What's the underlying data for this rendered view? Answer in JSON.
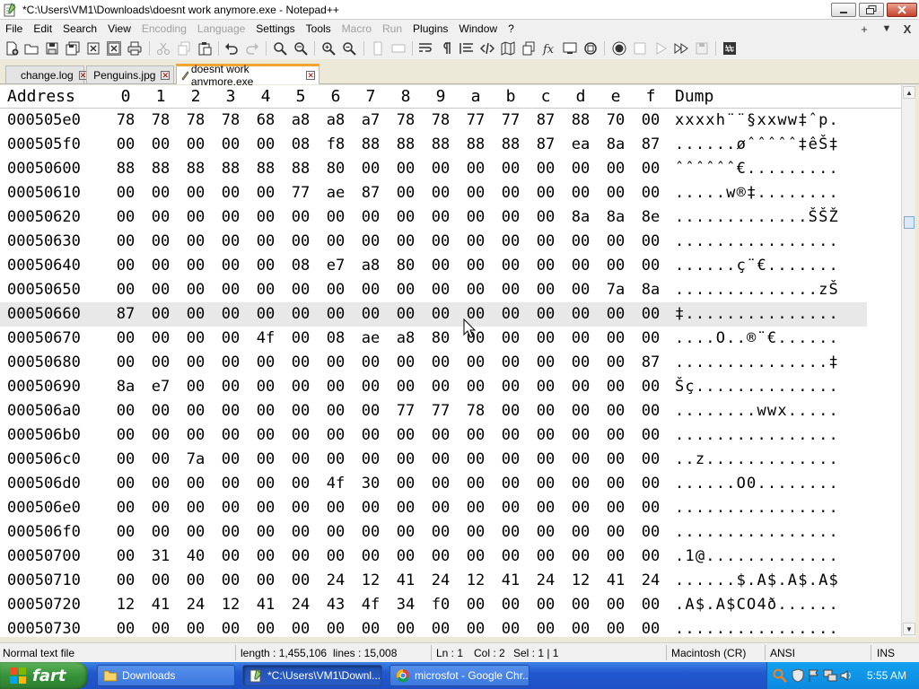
{
  "window": {
    "title": "*C:\\Users\\VM1\\Downloads\\doesnt work anymore.exe - Notepad++"
  },
  "menu": {
    "items": [
      {
        "label": "File",
        "enabled": true
      },
      {
        "label": "Edit",
        "enabled": true
      },
      {
        "label": "Search",
        "enabled": true
      },
      {
        "label": "View",
        "enabled": true
      },
      {
        "label": "Encoding",
        "enabled": false
      },
      {
        "label": "Language",
        "enabled": false
      },
      {
        "label": "Settings",
        "enabled": true
      },
      {
        "label": "Tools",
        "enabled": true
      },
      {
        "label": "Macro",
        "enabled": false
      },
      {
        "label": "Run",
        "enabled": false
      },
      {
        "label": "Plugins",
        "enabled": true
      },
      {
        "label": "Window",
        "enabled": true
      },
      {
        "label": "?",
        "enabled": true
      }
    ],
    "plus": "+",
    "dropdown": "▼",
    "close": "X"
  },
  "tabs": [
    {
      "label": "change.log",
      "active": false,
      "icon": "document-icon"
    },
    {
      "label": "Penguins.jpg",
      "active": false,
      "icon": "edit-icon"
    },
    {
      "label": "doesnt work anymore.exe",
      "active": true,
      "icon": "edit-icon"
    }
  ],
  "hex": {
    "header": {
      "address": "Address",
      "columns": [
        "0",
        "1",
        "2",
        "3",
        "4",
        "5",
        "6",
        "7",
        "8",
        "9",
        "a",
        "b",
        "c",
        "d",
        "e",
        "f"
      ],
      "dump": "Dump"
    },
    "current_row_index": 8,
    "rows": [
      {
        "addr": "000505e0",
        "bytes": [
          "78",
          "78",
          "78",
          "78",
          "68",
          "a8",
          "a8",
          "a7",
          "78",
          "78",
          "77",
          "77",
          "87",
          "88",
          "70",
          "00"
        ],
        "dump": "xxxxh¨¨§xxww‡ˆp."
      },
      {
        "addr": "000505f0",
        "bytes": [
          "00",
          "00",
          "00",
          "00",
          "00",
          "08",
          "f8",
          "88",
          "88",
          "88",
          "88",
          "88",
          "87",
          "ea",
          "8a",
          "87"
        ],
        "dump": "......øˆˆˆˆˆ‡êŠ‡"
      },
      {
        "addr": "00050600",
        "bytes": [
          "88",
          "88",
          "88",
          "88",
          "88",
          "88",
          "80",
          "00",
          "00",
          "00",
          "00",
          "00",
          "00",
          "00",
          "00",
          "00"
        ],
        "dump": "ˆˆˆˆˆˆ€........."
      },
      {
        "addr": "00050610",
        "bytes": [
          "00",
          "00",
          "00",
          "00",
          "00",
          "77",
          "ae",
          "87",
          "00",
          "00",
          "00",
          "00",
          "00",
          "00",
          "00",
          "00"
        ],
        "dump": ".....w®‡........"
      },
      {
        "addr": "00050620",
        "bytes": [
          "00",
          "00",
          "00",
          "00",
          "00",
          "00",
          "00",
          "00",
          "00",
          "00",
          "00",
          "00",
          "00",
          "8a",
          "8a",
          "8e"
        ],
        "dump": ".............ŠŠŽ"
      },
      {
        "addr": "00050630",
        "bytes": [
          "00",
          "00",
          "00",
          "00",
          "00",
          "00",
          "00",
          "00",
          "00",
          "00",
          "00",
          "00",
          "00",
          "00",
          "00",
          "00"
        ],
        "dump": "................"
      },
      {
        "addr": "00050640",
        "bytes": [
          "00",
          "00",
          "00",
          "00",
          "00",
          "08",
          "e7",
          "a8",
          "80",
          "00",
          "00",
          "00",
          "00",
          "00",
          "00",
          "00"
        ],
        "dump": "......ç¨€......."
      },
      {
        "addr": "00050650",
        "bytes": [
          "00",
          "00",
          "00",
          "00",
          "00",
          "00",
          "00",
          "00",
          "00",
          "00",
          "00",
          "00",
          "00",
          "00",
          "7a",
          "8a"
        ],
        "dump": "..............zŠ"
      },
      {
        "addr": "00050660",
        "bytes": [
          "87",
          "00",
          "00",
          "00",
          "00",
          "00",
          "00",
          "00",
          "00",
          "00",
          "00",
          "00",
          "00",
          "00",
          "00",
          "00"
        ],
        "dump": "‡..............."
      },
      {
        "addr": "00050670",
        "bytes": [
          "00",
          "00",
          "00",
          "00",
          "4f",
          "00",
          "08",
          "ae",
          "a8",
          "80",
          "00",
          "00",
          "00",
          "00",
          "00",
          "00"
        ],
        "dump": "....O..®¨€......"
      },
      {
        "addr": "00050680",
        "bytes": [
          "00",
          "00",
          "00",
          "00",
          "00",
          "00",
          "00",
          "00",
          "00",
          "00",
          "00",
          "00",
          "00",
          "00",
          "00",
          "87"
        ],
        "dump": "...............‡"
      },
      {
        "addr": "00050690",
        "bytes": [
          "8a",
          "e7",
          "00",
          "00",
          "00",
          "00",
          "00",
          "00",
          "00",
          "00",
          "00",
          "00",
          "00",
          "00",
          "00",
          "00"
        ],
        "dump": "Šç.............."
      },
      {
        "addr": "000506a0",
        "bytes": [
          "00",
          "00",
          "00",
          "00",
          "00",
          "00",
          "00",
          "00",
          "77",
          "77",
          "78",
          "00",
          "00",
          "00",
          "00",
          "00"
        ],
        "dump": "........wwx....."
      },
      {
        "addr": "000506b0",
        "bytes": [
          "00",
          "00",
          "00",
          "00",
          "00",
          "00",
          "00",
          "00",
          "00",
          "00",
          "00",
          "00",
          "00",
          "00",
          "00",
          "00"
        ],
        "dump": "................"
      },
      {
        "addr": "000506c0",
        "bytes": [
          "00",
          "00",
          "7a",
          "00",
          "00",
          "00",
          "00",
          "00",
          "00",
          "00",
          "00",
          "00",
          "00",
          "00",
          "00",
          "00"
        ],
        "dump": "..z............."
      },
      {
        "addr": "000506d0",
        "bytes": [
          "00",
          "00",
          "00",
          "00",
          "00",
          "00",
          "4f",
          "30",
          "00",
          "00",
          "00",
          "00",
          "00",
          "00",
          "00",
          "00"
        ],
        "dump": "......O0........"
      },
      {
        "addr": "000506e0",
        "bytes": [
          "00",
          "00",
          "00",
          "00",
          "00",
          "00",
          "00",
          "00",
          "00",
          "00",
          "00",
          "00",
          "00",
          "00",
          "00",
          "00"
        ],
        "dump": "................"
      },
      {
        "addr": "000506f0",
        "bytes": [
          "00",
          "00",
          "00",
          "00",
          "00",
          "00",
          "00",
          "00",
          "00",
          "00",
          "00",
          "00",
          "00",
          "00",
          "00",
          "00"
        ],
        "dump": "................"
      },
      {
        "addr": "00050700",
        "bytes": [
          "00",
          "31",
          "40",
          "00",
          "00",
          "00",
          "00",
          "00",
          "00",
          "00",
          "00",
          "00",
          "00",
          "00",
          "00",
          "00"
        ],
        "dump": ".1@............."
      },
      {
        "addr": "00050710",
        "bytes": [
          "00",
          "00",
          "00",
          "00",
          "00",
          "00",
          "24",
          "12",
          "41",
          "24",
          "12",
          "41",
          "24",
          "12",
          "41",
          "24"
        ],
        "dump": "......$.A$.A$.A$"
      },
      {
        "addr": "00050720",
        "bytes": [
          "12",
          "41",
          "24",
          "12",
          "41",
          "24",
          "43",
          "4f",
          "34",
          "f0",
          "00",
          "00",
          "00",
          "00",
          "00",
          "00"
        ],
        "dump": ".A$.A$CO4ð......"
      },
      {
        "addr": "00050730",
        "bytes": [
          "00",
          "00",
          "00",
          "00",
          "00",
          "00",
          "00",
          "00",
          "00",
          "00",
          "00",
          "00",
          "00",
          "00",
          "00",
          "00"
        ],
        "dump": "................"
      }
    ]
  },
  "status": {
    "file_type": "Normal text file",
    "length": "length : 1,455,106",
    "lines": "lines : 15,008",
    "ln": "Ln : 1",
    "col": "Col : 2",
    "sel": "Sel : 1 | 1",
    "eol": "Macintosh (CR)",
    "encoding": "ANSI",
    "mode": "INS"
  },
  "taskbar": {
    "start_label": "fart",
    "tasks": [
      {
        "label": "Downloads",
        "icon": "folder-icon",
        "active": false
      },
      {
        "label": "*C:\\Users\\VM1\\Downl...",
        "icon": "notepad-icon",
        "active": true
      },
      {
        "label": "microsfot - Google Chr...",
        "icon": "chrome-icon",
        "active": false
      }
    ],
    "clock": "5:55 AM"
  },
  "colors": {
    "tab_accent": "#f4a531",
    "taskbar": "#2358d0",
    "start": "#36923a",
    "tray": "#0d8ae0"
  }
}
